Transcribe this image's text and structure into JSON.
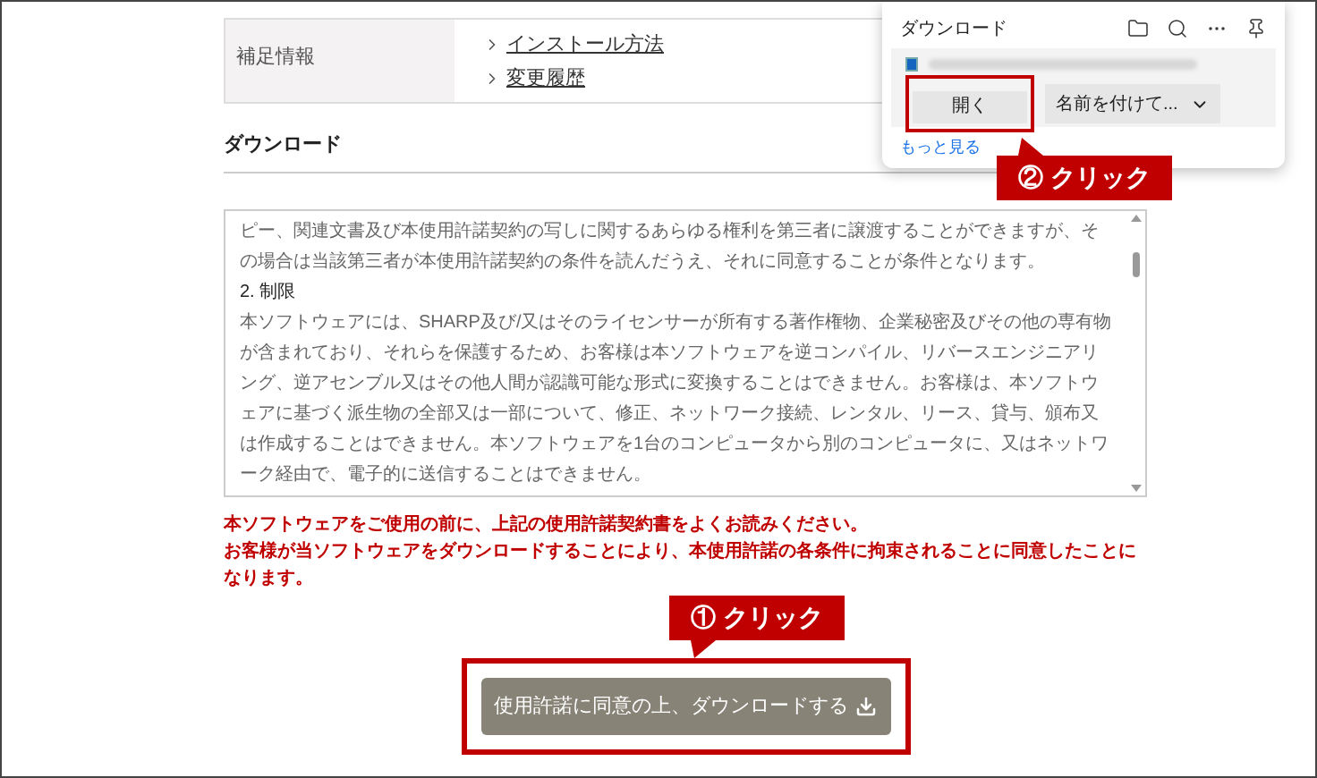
{
  "info_table": {
    "label": "補足情報",
    "links": [
      {
        "text": "インストール方法"
      },
      {
        "text": "変更履歴"
      }
    ]
  },
  "download_section": {
    "heading": "ダウンロード",
    "license_text": [
      {
        "kind": "paragraph",
        "text": "ピー、関連文書及び本使用許諾契約の写しに関するあらゆる権利を第三者に譲渡することができますが、その場合は当該第三者が本使用許諾契約の条件を読んだうえ、それに同意することが条件となります。"
      },
      {
        "kind": "heading",
        "text": "2. 制限"
      },
      {
        "kind": "paragraph",
        "text": "本ソフトウェアには、SHARP及び/又はそのライセンサーが所有する著作権物、企業秘密及びその他の専有物が含まれており、それらを保護するため、お客様は本ソフトウェアを逆コンパイル、リバースエンジニアリング、逆アセンブル又はその他人間が認識可能な形式に変換することはできません。お客様は、本ソフトウェアに基づく派生物の全部又は一部について、修正、ネットワーク接続、レンタル、リース、貸与、頒布又は作成することはできません。本ソフトウェアを1台のコンピュータから別のコンピュータに、又はネットワーク経由で、電子的に送信することはできません。"
      }
    ],
    "notice": [
      "本ソフトウェアをご使用の前に、上記の使用許諾契約書をよくお読みください。",
      "お客様が当ソフトウェアをダウンロードすることにより、本使用許諾の各条件に拘束されることに同意したことになります。"
    ],
    "download_button": {
      "label": "使用許諾に同意の上、ダウンロードする"
    }
  },
  "annotations": [
    {
      "label": "① クリック"
    },
    {
      "label": "② クリック"
    }
  ],
  "downloads_panel": {
    "title": "ダウンロード",
    "open_button": "開く",
    "save_as_button": "名前を付けて...",
    "more_link": "もっと見る"
  }
}
